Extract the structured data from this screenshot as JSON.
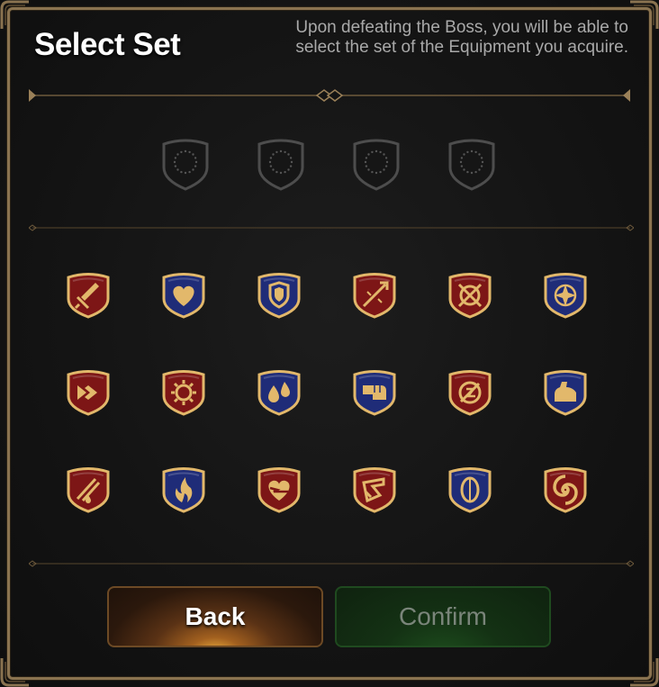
{
  "header": {
    "title": "Select Set",
    "notice": "Upon defeating the Boss, you will be able to select the set of the Equipment you acquire."
  },
  "selected_slots": [
    {
      "state": "empty"
    },
    {
      "state": "empty"
    },
    {
      "state": "empty"
    },
    {
      "state": "empty"
    }
  ],
  "sets": [
    {
      "icon": "sword-icon",
      "color": "#7d1616"
    },
    {
      "icon": "heart-icon",
      "color": "#1f2c78"
    },
    {
      "icon": "shield-icon",
      "color": "#1f2c78"
    },
    {
      "icon": "broken-spear-icon",
      "color": "#7d1616"
    },
    {
      "icon": "target-crosshair-icon",
      "color": "#7d1616"
    },
    {
      "icon": "four-point-star-icon",
      "color": "#1f2c78"
    },
    {
      "icon": "speed-arrow-icon",
      "color": "#7d1616"
    },
    {
      "icon": "sun-burst-icon",
      "color": "#7d1616"
    },
    {
      "icon": "water-drops-icon",
      "color": "#1f2c78"
    },
    {
      "icon": "fist-icon",
      "color": "#1f2c78"
    },
    {
      "icon": "slashed-circle-icon",
      "color": "#7d1616"
    },
    {
      "icon": "flexed-arm-icon",
      "color": "#1f2c78"
    },
    {
      "icon": "bleeding-slash-icon",
      "color": "#7d1616"
    },
    {
      "icon": "flame-icon",
      "color": "#1f2c78"
    },
    {
      "icon": "cracked-heart-icon",
      "color": "#7d1616"
    },
    {
      "icon": "claw-strike-icon",
      "color": "#7d1616"
    },
    {
      "icon": "oval-shield-icon",
      "color": "#1f2c78"
    },
    {
      "icon": "swirl-icon",
      "color": "#7d1616"
    }
  ],
  "buttons": {
    "back_label": "Back",
    "confirm_label": "Confirm"
  },
  "colors": {
    "frame_gold": "#8a7350",
    "badge_gold": "#e2b86b",
    "badge_red": "#7d1616",
    "badge_blue": "#1f2c78",
    "confirm_text": "#7a857a"
  }
}
